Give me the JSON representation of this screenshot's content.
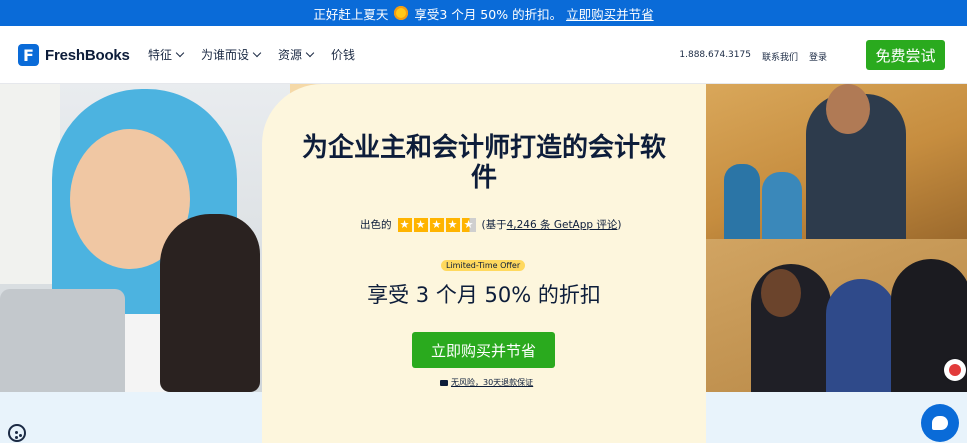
{
  "promo": {
    "text": "正好赶上夏天",
    "offer_text": "享受3 个月 50% 的折扣。",
    "link": "立即购买并节省"
  },
  "nav": {
    "logo": "FreshBooks",
    "logo_mark": "F",
    "menu": [
      {
        "label": "特征",
        "has_dropdown": true
      },
      {
        "label": "为谁而设",
        "has_dropdown": true
      },
      {
        "label": "资源",
        "has_dropdown": true
      },
      {
        "label": "价钱",
        "has_dropdown": false
      }
    ],
    "phone": "1.888.674.3175",
    "contact": "联系我们",
    "login": "登录",
    "cta": "免费尝试"
  },
  "hero": {
    "title": "为企业主和会计师打造的会计软件",
    "rating_label": "出色的",
    "rating_stars": 4.5,
    "review_prefix": "(基于",
    "review_link": "4,246 条 GetApp 评论",
    "review_suffix": ")",
    "badge": "Limited-Time Offer",
    "offer": "享受 3 个月 50% 的折扣",
    "buy_button": "立即购买并节省",
    "guarantee": "无风险，30天退款保证"
  },
  "colors": {
    "brand_blue": "#0a6bd8",
    "cta_green": "#2aaa1e",
    "hero_card": "#fdf6dd",
    "star": "#ffb400",
    "badge": "#ffd95e"
  },
  "icons": {
    "sun": "sun-icon",
    "cookie": "cookie-icon",
    "chat": "chat-icon",
    "star": "star-icon"
  }
}
